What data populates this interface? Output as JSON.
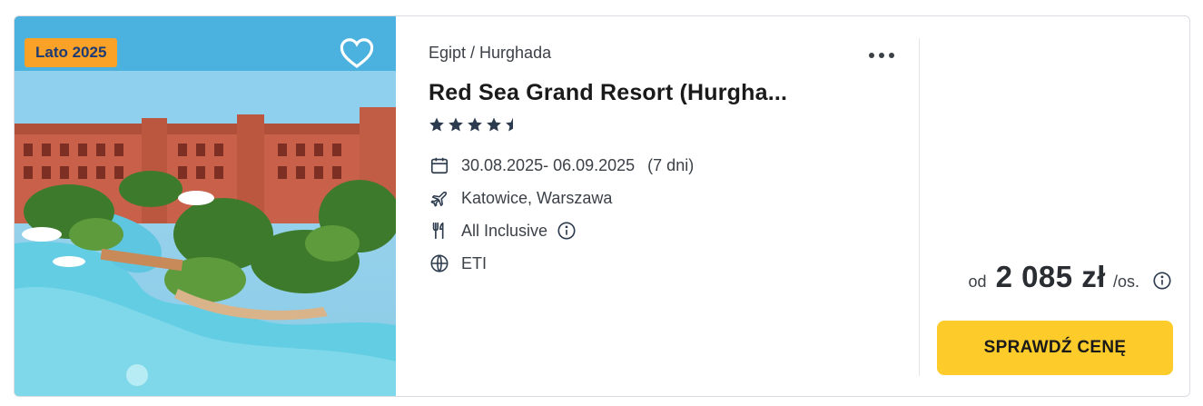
{
  "offer": {
    "season_badge": "Lato 2025",
    "location": "Egipt / Hurghada",
    "hotel_name": "Red Sea Grand Resort (Hurgha...",
    "rating_stars": 4.5,
    "dates": "30.08.2025- 06.09.2025",
    "duration": "(7 dni)",
    "departure": "Katowice, Warszawa",
    "board": "All Inclusive",
    "operator": "ETI",
    "price_prefix": "od",
    "price": "2 085 zł",
    "price_unit": "/os.",
    "cta_label": "SPRAWDŹ CENĘ"
  },
  "icons": {
    "favorite": "heart-icon",
    "more": "more-options-icon",
    "star": "star-icon",
    "calendar": "calendar-icon",
    "flight": "plane-icon",
    "board": "cutlery-icon",
    "operator": "globe-icon",
    "info": "info-icon"
  },
  "colors": {
    "badge_bg": "#f9a227",
    "badge_text": "#1f3b73",
    "cta_bg": "#fdcb2a",
    "text_primary": "#1a1a1a",
    "text_secondary": "#3c4148"
  }
}
